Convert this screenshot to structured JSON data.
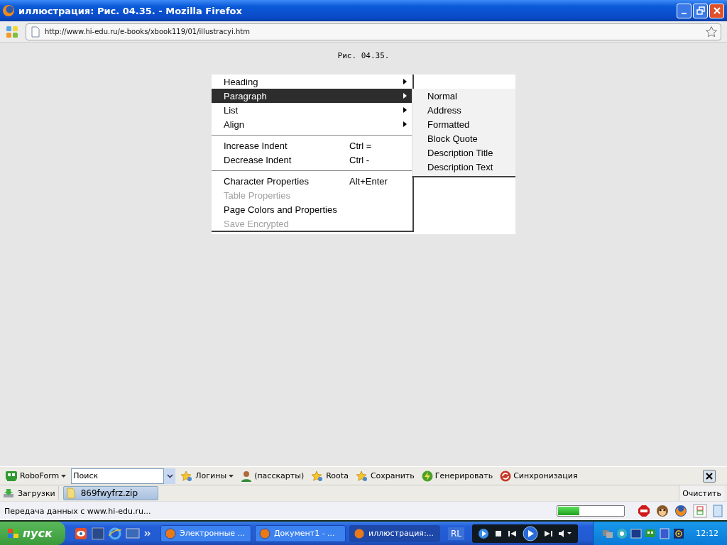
{
  "window": {
    "title": "иллюстрация: Рис. 04.35. - Mozilla Firefox"
  },
  "address_bar": {
    "url": "http://www.hi-edu.ru/e-books/xbook119/01/illustracyi.htm"
  },
  "page": {
    "caption": "Рис. 04.35.",
    "menu": [
      {
        "kind": "item",
        "label": "Heading",
        "submenu": true,
        "selected": false,
        "disabled": false
      },
      {
        "kind": "item",
        "label": "Paragraph",
        "submenu": true,
        "selected": true,
        "disabled": false
      },
      {
        "kind": "item",
        "label": "List",
        "submenu": true,
        "selected": false,
        "disabled": false
      },
      {
        "kind": "item",
        "label": "Align",
        "submenu": true,
        "selected": false,
        "disabled": false
      },
      {
        "kind": "separator"
      },
      {
        "kind": "item",
        "label": "Increase Indent",
        "shortcut": "Ctrl =",
        "submenu": false,
        "selected": false,
        "disabled": false
      },
      {
        "kind": "item",
        "label": "Decrease Indent",
        "shortcut": "Ctrl -",
        "submenu": false,
        "selected": false,
        "disabled": false
      },
      {
        "kind": "separator"
      },
      {
        "kind": "item",
        "label": "Character Properties",
        "shortcut": "Alt+Enter",
        "submenu": false,
        "selected": false,
        "disabled": false
      },
      {
        "kind": "item",
        "label": "Table Properties",
        "submenu": false,
        "selected": false,
        "disabled": true
      },
      {
        "kind": "item",
        "label": "Page Colors and Properties",
        "submenu": false,
        "selected": false,
        "disabled": false
      },
      {
        "kind": "item",
        "label": "Save Encrypted",
        "submenu": false,
        "selected": false,
        "disabled": true
      }
    ],
    "submenu": [
      "Normal",
      "Address",
      "Formatted",
      "Block Quote",
      "Description Title",
      "Description Text"
    ]
  },
  "roboform_toolbar": {
    "items": [
      {
        "kind": "menu",
        "label": "RoboForm"
      },
      {
        "kind": "search",
        "placeholder": "Поиск"
      },
      {
        "kind": "menu",
        "label": "Логины"
      },
      {
        "kind": "button",
        "label": "(пасскарты)"
      },
      {
        "kind": "button",
        "label": "Roota"
      },
      {
        "kind": "button",
        "label": "Сохранить"
      },
      {
        "kind": "button",
        "label": "Генерировать"
      },
      {
        "kind": "button",
        "label": "Синхронизация"
      }
    ]
  },
  "downloads_bar": {
    "label": "Загрузки",
    "file": "869fwyfrz.zip",
    "clear": "Очистить"
  },
  "status_bar": {
    "text": "Передача данных с www.hi-edu.ru...",
    "progress": {
      "level": 0.33
    }
  },
  "taskbar": {
    "start": "пуск",
    "tasks": [
      {
        "label": "Электронные ...",
        "selected": false
      },
      {
        "label": "Документ1 - ...",
        "selected": false
      },
      {
        "label": "иллюстрация:...",
        "selected": true
      }
    ],
    "language": "RL",
    "clock": "12:12"
  }
}
